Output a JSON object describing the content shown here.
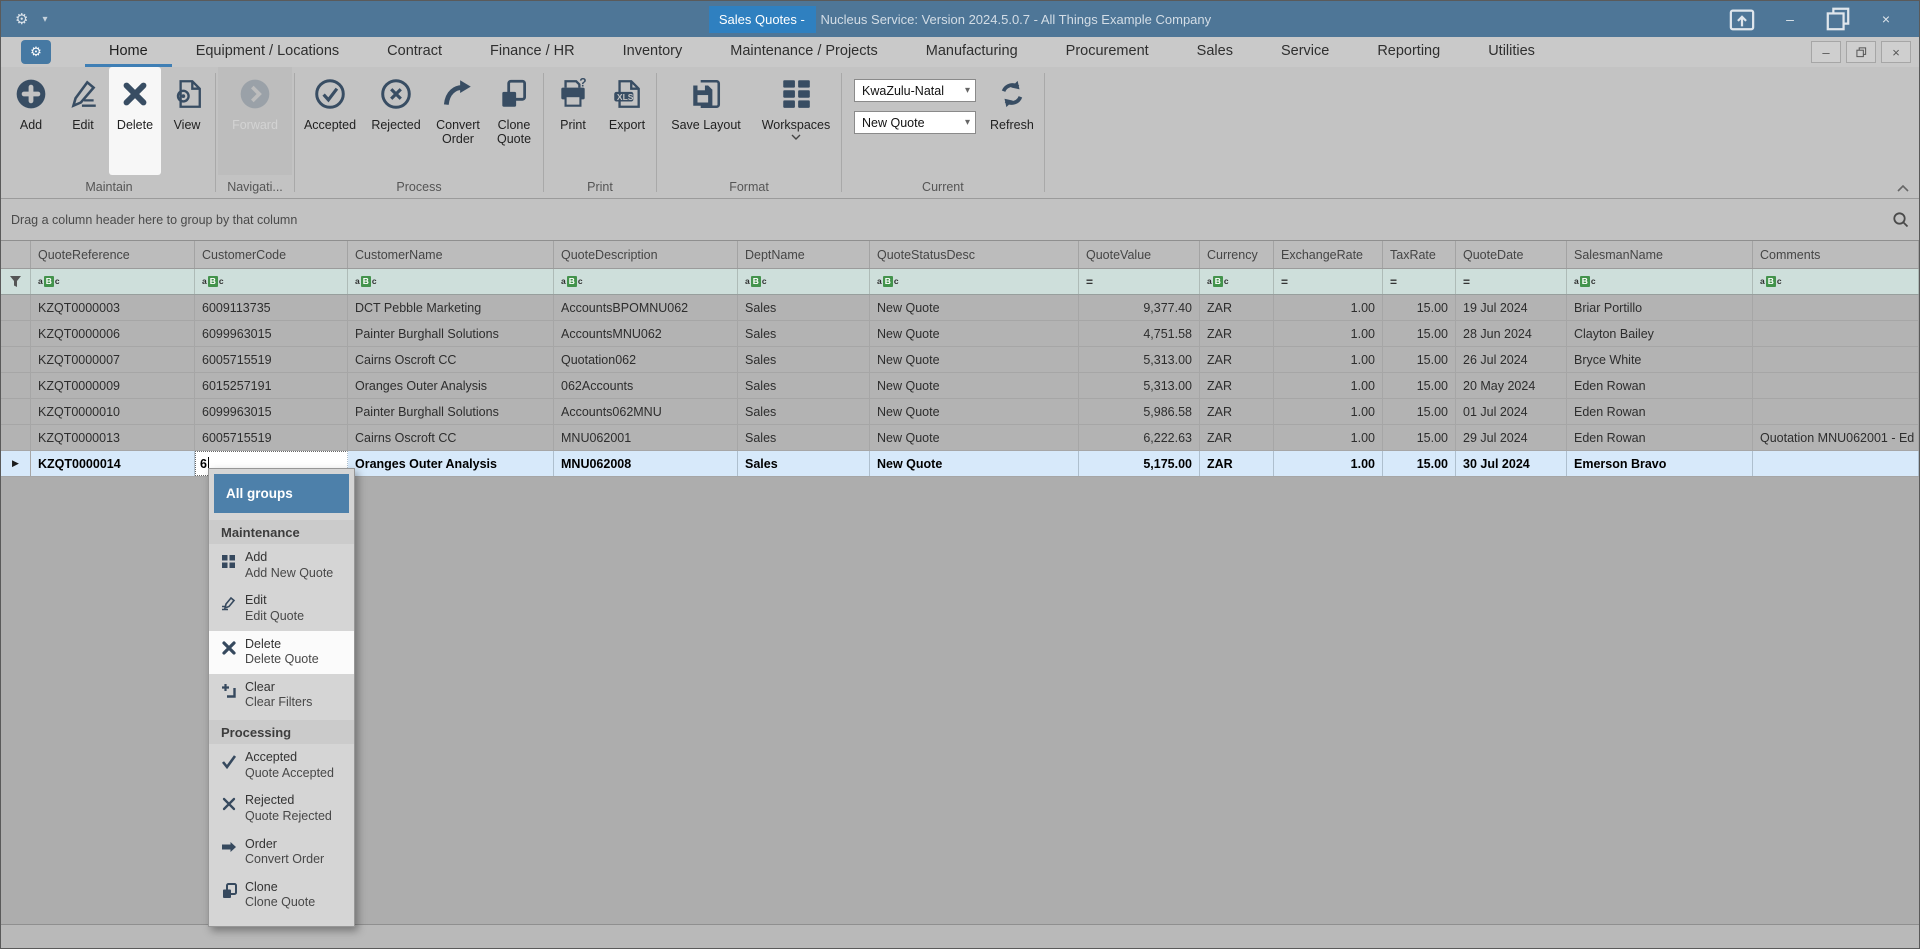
{
  "title_bar": {
    "active_doc": "Sales Quotes - ",
    "app_title": "Nucleus Service: Version 2024.5.0.7 - All Things Example Company"
  },
  "ribbon": {
    "tabs": [
      "Home",
      "Equipment / Locations",
      "Contract",
      "Finance / HR",
      "Inventory",
      "Maintenance / Projects",
      "Manufacturing",
      "Procurement",
      "Sales",
      "Service",
      "Reporting",
      "Utilities"
    ],
    "active_tab": "Home",
    "buttons": {
      "add": "Add",
      "edit": "Edit",
      "delete": "Delete",
      "view": "View",
      "forward": "Forward",
      "accepted": "Accepted",
      "rejected": "Rejected",
      "convert_order": "Convert\nOrder",
      "clone_quote": "Clone\nQuote",
      "print": "Print",
      "export": "Export",
      "save_layout": "Save Layout",
      "workspaces": "Workspaces",
      "refresh": "Refresh"
    },
    "group_labels": {
      "maintain": "Maintain",
      "navigation": "Navigati...",
      "process": "Process",
      "print": "Print",
      "format": "Format",
      "current": "Current"
    },
    "region_select": "KwaZulu-Natal",
    "status_select": "New Quote"
  },
  "grid": {
    "group_by_hint": "Drag a column header here to group by that column",
    "columns": [
      {
        "label": "QuoteReference",
        "filter": "abc"
      },
      {
        "label": "CustomerCode",
        "filter": "abc"
      },
      {
        "label": "CustomerName",
        "filter": "abc"
      },
      {
        "label": "QuoteDescription",
        "filter": "abc"
      },
      {
        "label": "DeptName",
        "filter": "abc"
      },
      {
        "label": "QuoteStatusDesc",
        "filter": "abc"
      },
      {
        "label": "QuoteValue",
        "filter": "eq"
      },
      {
        "label": "Currency",
        "filter": "abc"
      },
      {
        "label": "ExchangeRate",
        "filter": "eq"
      },
      {
        "label": "TaxRate",
        "filter": "eq"
      },
      {
        "label": "QuoteDate",
        "filter": "eq"
      },
      {
        "label": "SalesmanName",
        "filter": "abc"
      },
      {
        "label": "Comments",
        "filter": "abc"
      }
    ],
    "rows": [
      [
        "KZQT0000003",
        "6009113735",
        "DCT Pebble Marketing",
        "AccountsBPOMNU062",
        "Sales",
        "New Quote",
        "9,377.40",
        "ZAR",
        "1.00",
        "15.00",
        "19 Jul 2024",
        "Briar Portillo",
        ""
      ],
      [
        "KZQT0000006",
        "6099963015",
        "Painter Burghall Solutions",
        "AccountsMNU062",
        "Sales",
        "New Quote",
        "4,751.58",
        "ZAR",
        "1.00",
        "15.00",
        "28 Jun 2024",
        "Clayton Bailey",
        ""
      ],
      [
        "KZQT0000007",
        "6005715519",
        "Cairns Oscroft CC",
        "Quotation062",
        "Sales",
        "New Quote",
        "5,313.00",
        "ZAR",
        "1.00",
        "15.00",
        "26 Jul 2024",
        "Bryce White",
        ""
      ],
      [
        "KZQT0000009",
        "6015257191",
        "Oranges Outer Analysis",
        "062Accounts",
        "Sales",
        "New Quote",
        "5,313.00",
        "ZAR",
        "1.00",
        "15.00",
        "20 May 2024",
        "Eden Rowan",
        ""
      ],
      [
        "KZQT0000010",
        "6099963015",
        "Painter Burghall Solutions",
        "Accounts062MNU",
        "Sales",
        "New Quote",
        "5,986.58",
        "ZAR",
        "1.00",
        "15.00",
        "01 Jul 2024",
        "Eden Rowan",
        ""
      ],
      [
        "KZQT0000013",
        "6005715519",
        "Cairns Oscroft CC",
        "MNU062001",
        "Sales",
        "New Quote",
        "6,222.63",
        "ZAR",
        "1.00",
        "15.00",
        "29 Jul 2024",
        "Eden Rowan",
        "Quotation MNU062001 - Ed"
      ],
      [
        "KZQT0000014",
        "6",
        "Oranges Outer Analysis",
        "MNU062008",
        "Sales",
        "New Quote",
        "5,175.00",
        "ZAR",
        "1.00",
        "15.00",
        "30 Jul 2024",
        "Emerson Bravo",
        ""
      ]
    ],
    "selected_row_index": 6,
    "edit_value": "6"
  },
  "context_menu": {
    "header": "All groups",
    "sections": [
      {
        "title": "Maintenance",
        "items": [
          {
            "label": "Add",
            "sublabel": "Add New Quote",
            "icon": "menu-add-icon"
          },
          {
            "label": "Edit",
            "sublabel": "Edit Quote",
            "icon": "menu-edit-icon"
          },
          {
            "label": "Delete",
            "sublabel": "Delete Quote",
            "icon": "menu-delete-icon",
            "highlighted": true
          },
          {
            "label": "Clear",
            "sublabel": "Clear Filters",
            "icon": "menu-clear-icon"
          }
        ]
      },
      {
        "title": "Processing",
        "items": [
          {
            "label": "Accepted",
            "sublabel": "Quote Accepted",
            "icon": "menu-accepted-icon"
          },
          {
            "label": "Rejected",
            "sublabel": "Quote Rejected",
            "icon": "menu-rejected-icon"
          },
          {
            "label": "Order",
            "sublabel": "Convert Order",
            "icon": "menu-order-icon"
          },
          {
            "label": "Clone",
            "sublabel": "Clone Quote",
            "icon": "menu-clone-icon"
          }
        ]
      }
    ],
    "footer": "..."
  },
  "colors": {
    "titlebar": "#4e7697",
    "active_doc_chip": "#2f80c0",
    "ribbon_bg": "#c3c3c3",
    "filter_row_bg": "#cedfdb",
    "selected_row_bg": "#d7e9fa",
    "menu_header_bg": "#4d80aa",
    "icon": "#384d63",
    "abc_green": "#43934c"
  }
}
